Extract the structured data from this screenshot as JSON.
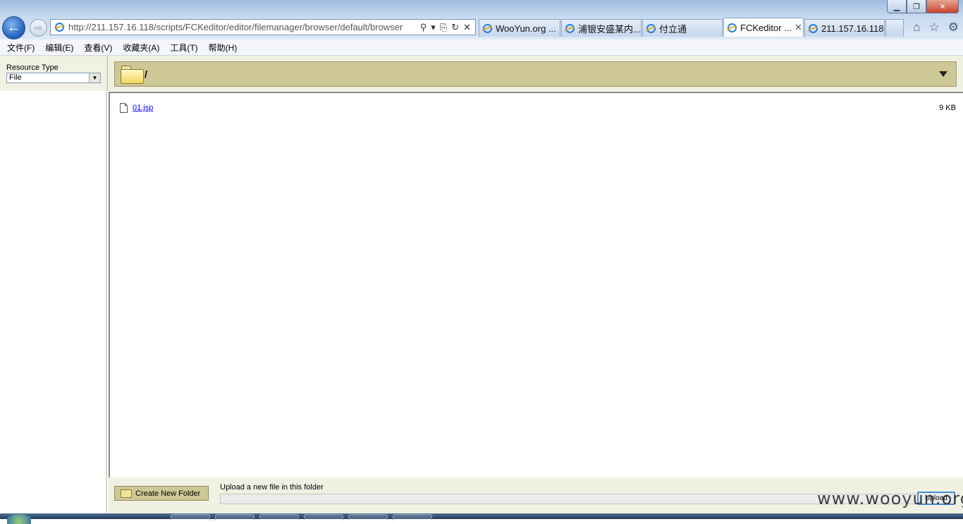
{
  "window": {
    "ghost_title": "",
    "minimize_glyph": "▁",
    "maximize_glyph": "❐",
    "close_glyph": "✕"
  },
  "nav": {
    "back_icon": "back-arrow-icon",
    "back_glyph": "←",
    "forward_icon": "forward-arrow-icon",
    "forward_glyph": "⇨"
  },
  "address": {
    "url": "http://211.157.16.118/scripts/FCKeditor/editor/filemanager/browser/default/browser",
    "search_glyph": "⚲",
    "dropdown_glyph": "▾",
    "compat_glyph": "⎘",
    "refresh_glyph": "↻",
    "stop_glyph": "✕"
  },
  "tabs": [
    {
      "label": "WooYun.org ...",
      "active": false,
      "width": 116
    },
    {
      "label": "浦银安盛某内...",
      "active": false,
      "width": 114
    },
    {
      "label": "付立通",
      "active": false,
      "width": 114
    },
    {
      "label": "FCKeditor ...",
      "active": true,
      "width": 114
    },
    {
      "label": "211.157.16.118",
      "active": false,
      "width": 114
    }
  ],
  "tab_close_glyph": "✕",
  "toolbar_right": {
    "home_glyph": "⌂",
    "favorites_glyph": "☆",
    "tools_glyph": "⚙"
  },
  "menu": [
    "文件(F)",
    "编辑(E)",
    "查看(V)",
    "收藏夹(A)",
    "工具(T)",
    "帮助(H)"
  ],
  "resource": {
    "label": "Resource Type",
    "selected": "File",
    "arrow_glyph": "▼"
  },
  "folder": {
    "path": "/"
  },
  "files": [
    {
      "name": "01.jsp",
      "size": "9 KB"
    }
  ],
  "bottom": {
    "create_folder": "Create New Folder",
    "upload_label": "Upload a new file in this folder",
    "upload_button": "Upload"
  },
  "watermark": "www.wooyun.org"
}
